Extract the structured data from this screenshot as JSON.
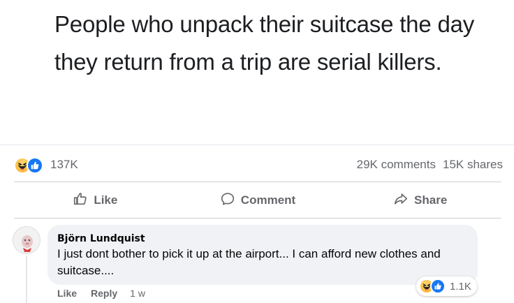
{
  "post": {
    "text": "People who unpack their suitcase the day they return from a trip are serial killers."
  },
  "stats": {
    "reaction_icons": [
      "haha-icon",
      "like-icon"
    ],
    "reaction_count": "137K",
    "comments": "29K comments",
    "shares": "15K shares"
  },
  "actions": {
    "like": "Like",
    "comment": "Comment",
    "share": "Share"
  },
  "comment": {
    "author": "Björn Lundquist",
    "text": "I just dont bother to pick it up at the airport... I can afford new clothes and suitcase....",
    "reaction_count": "1.1K",
    "like_label": "Like",
    "reply_label": "Reply",
    "time": "1 w"
  },
  "colors": {
    "like_blue": "#1877f2",
    "haha_yellow": "#f7b125",
    "muted_text": "#65676b",
    "bubble_bg": "#f0f2f5"
  }
}
